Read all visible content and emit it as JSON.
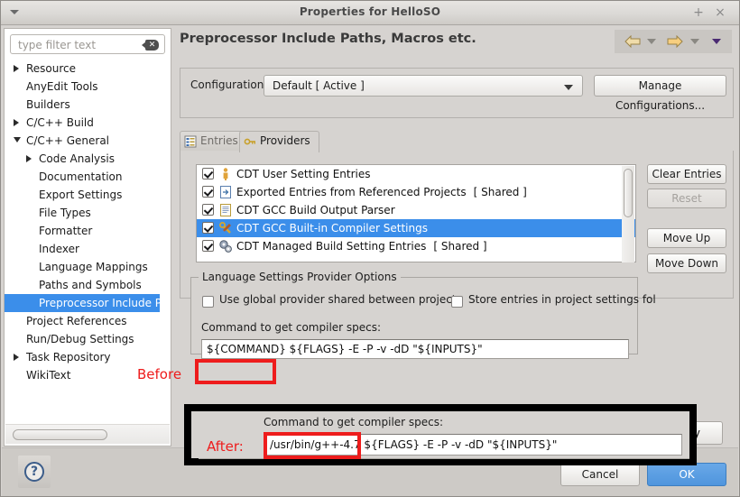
{
  "window": {
    "title": "Properties for HelloSO",
    "menu_icon": "triangle-down-icon",
    "maximize_label": "+",
    "close_label": "×"
  },
  "sidebar": {
    "filter": {
      "placeholder": "type filter text",
      "value": "",
      "clear_icon": "clear-filter-icon"
    },
    "items": [
      {
        "label": "Resource",
        "indent": 0,
        "expander": "closed",
        "selected": false
      },
      {
        "label": "AnyEdit Tools",
        "indent": 0,
        "expander": "none",
        "selected": false
      },
      {
        "label": "Builders",
        "indent": 0,
        "expander": "none",
        "selected": false
      },
      {
        "label": "C/C++ Build",
        "indent": 0,
        "expander": "closed",
        "selected": false
      },
      {
        "label": "C/C++ General",
        "indent": 0,
        "expander": "open",
        "selected": false
      },
      {
        "label": "Code Analysis",
        "indent": 1,
        "expander": "closed",
        "selected": false
      },
      {
        "label": "Documentation",
        "indent": 1,
        "expander": "none",
        "selected": false
      },
      {
        "label": "Export Settings",
        "indent": 1,
        "expander": "none",
        "selected": false
      },
      {
        "label": "File Types",
        "indent": 1,
        "expander": "none",
        "selected": false
      },
      {
        "label": "Formatter",
        "indent": 1,
        "expander": "none",
        "selected": false
      },
      {
        "label": "Indexer",
        "indent": 1,
        "expander": "none",
        "selected": false
      },
      {
        "label": "Language Mappings",
        "indent": 1,
        "expander": "none",
        "selected": false
      },
      {
        "label": "Paths and Symbols",
        "indent": 1,
        "expander": "none",
        "selected": false
      },
      {
        "label": "Preprocessor Include Pat",
        "indent": 1,
        "expander": "none",
        "selected": true
      },
      {
        "label": "Project References",
        "indent": 0,
        "expander": "none",
        "selected": false
      },
      {
        "label": "Run/Debug Settings",
        "indent": 0,
        "expander": "none",
        "selected": false
      },
      {
        "label": "Task Repository",
        "indent": 0,
        "expander": "closed",
        "selected": false
      },
      {
        "label": "WikiText",
        "indent": 0,
        "expander": "none",
        "selected": false
      }
    ],
    "selection_color": "#3b8eea"
  },
  "page": {
    "title": "Preprocessor Include Paths, Macros etc.",
    "nav": {
      "back_icon": "arrow-left-icon",
      "forward_icon": "arrow-right-icon",
      "back_menu_icon": "chevron-down-icon",
      "forward_menu_icon": "chevron-down-icon",
      "view_menu_icon": "chevron-down-icon"
    }
  },
  "configuration": {
    "label": "Configuration:",
    "selected": "Default  [ Active ]",
    "dropdown_icon": "chevron-down-icon",
    "manage_button": "Manage Configurations..."
  },
  "tabs": [
    {
      "label": "Entries",
      "icon": "entries-icon",
      "active": false
    },
    {
      "label": "Providers",
      "icon": "providers-icon",
      "active": true
    }
  ],
  "providers": {
    "rows": [
      {
        "label": "CDT User Setting Entries",
        "suffix": "",
        "checked": true,
        "selected": false,
        "icon": "person-icon"
      },
      {
        "label": "Exported Entries from Referenced Projects",
        "suffix": "[ Shared ]",
        "checked": true,
        "selected": false,
        "icon": "export-page-icon"
      },
      {
        "label": "CDT GCC Build Output Parser",
        "suffix": "",
        "checked": true,
        "selected": false,
        "icon": "document-icon"
      },
      {
        "label": "CDT GCC Built-in Compiler Settings",
        "suffix": "",
        "checked": true,
        "selected": true,
        "icon": "key-wrench-icon"
      },
      {
        "label": "CDT Managed Build Setting Entries",
        "suffix": "[ Shared ]",
        "checked": true,
        "selected": false,
        "icon": "gears-icon"
      }
    ],
    "buttons": {
      "clear_entries": "Clear Entries",
      "reset": "Reset",
      "move_up": "Move Up",
      "move_down": "Move Down"
    },
    "reset_enabled": false
  },
  "options_group": {
    "legend": "Language Settings Provider Options",
    "checkbox_global": {
      "label": "Use global provider shared between projects",
      "checked": false
    },
    "checkbox_store": {
      "label": "Store entries in project settings fol",
      "checked": false
    },
    "command_label": "Command to get compiler specs:",
    "command_value": "${COMMAND} ${FLAGS} -E -P -v -dD \"${INPUTS}\""
  },
  "annotations": {
    "before_label": "Before",
    "after_label": "After:",
    "highlight_color": "#ee1c1c",
    "outline_color": "#000000"
  },
  "after_panel": {
    "command_label": "Command to get compiler specs:",
    "command_value": "/usr/bin/g++-4.7 ${FLAGS} -E -P -v -dD \"${INPUTS}\""
  },
  "footer": {
    "help_icon": "question-mark-icon",
    "apply_button": "Apply",
    "cancel_button": "Cancel",
    "ok_button": "OK",
    "ok_color": "#4f95dd"
  }
}
